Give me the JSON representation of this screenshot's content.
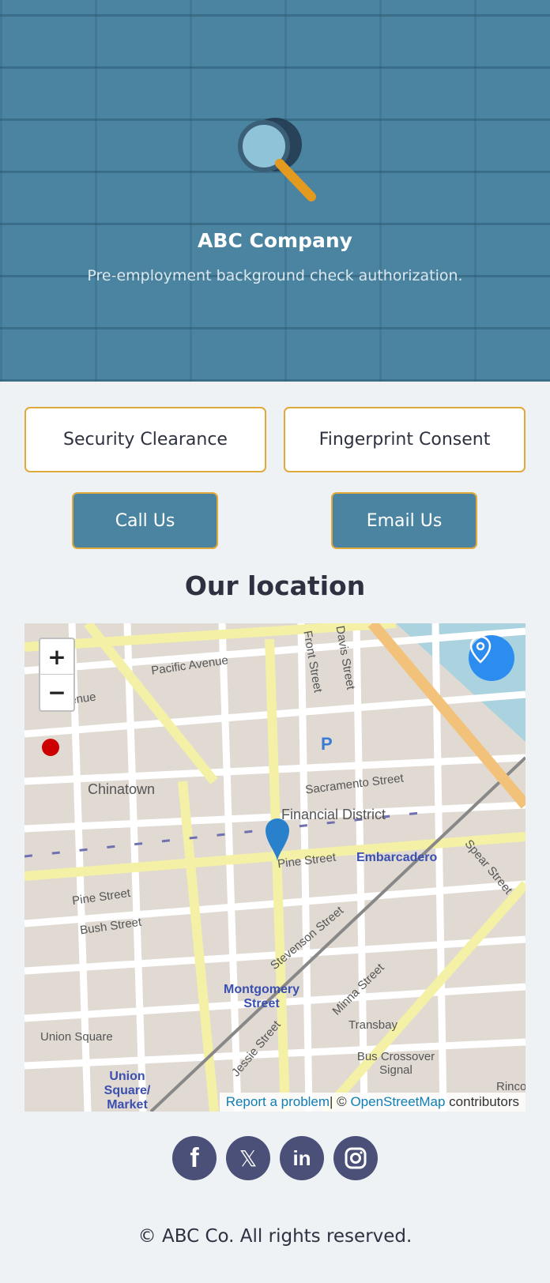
{
  "header": {
    "title": "ABC Company",
    "subtitle": "Pre-employment background check authorization.",
    "logo_icon": "magnifying-glass-fingerprint-icon"
  },
  "buttons": {
    "security": "Security Clearance",
    "fingerprint": "Fingerprint Consent",
    "call": "Call Us",
    "email": "Email Us"
  },
  "location": {
    "heading": "Our location",
    "map": {
      "zoom_in": "+",
      "zoom_out": "−",
      "report": "Report a problem",
      "copyright": "| © ",
      "osm": "OpenStreetMap",
      "contributors": " contributors",
      "labels": [
        "Pacific Avenue",
        "Avenue",
        "Chinatown",
        "Front Street",
        "Davis Street",
        "Sacramento Street",
        "Financial District",
        "Pine Street",
        "Embarcadero",
        "Spear Street",
        "Pine Street",
        "Bush Street",
        "Stevenson Street",
        "Montgomery Street",
        "Minna Street",
        "Transbay",
        "Jessie Street",
        "Union Square",
        "Bus Crossover Signal",
        "Union Square/ Market",
        "Rinco",
        "P"
      ]
    }
  },
  "social": [
    "facebook-icon",
    "x-icon",
    "linkedin-icon",
    "instagram-icon"
  ],
  "footer": {
    "text": "© ABC Co. All rights reserved."
  },
  "colors": {
    "primary": "#4a84a0",
    "accent": "#e0a93c",
    "social": "#4a5078"
  }
}
